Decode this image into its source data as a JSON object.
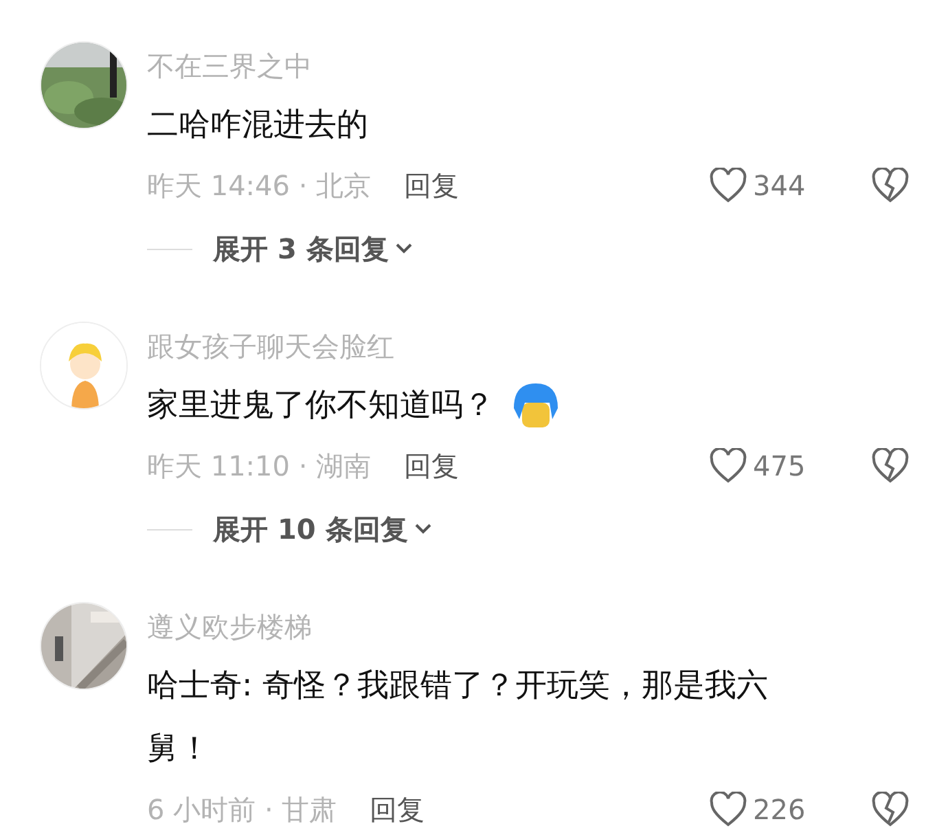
{
  "comments": [
    {
      "username": "不在三界之中",
      "content": "二哈咋混进去的",
      "sticker": false,
      "time_location": "昨天 14:46 · 北京",
      "reply_label": "回复",
      "likes": "344",
      "expand_label": "展开 3 条回复"
    },
    {
      "avatar": {
        "kind": "cartoon"
      },
      "username": "跟女孩子聊天会脸红",
      "content": "家里进鬼了你不知道吗？",
      "sticker": true,
      "time_location": "昨天 11:10 · 湖南",
      "reply_label": "回复",
      "likes": "475",
      "expand_label": "展开 10 条回复"
    },
    {
      "avatar": {
        "kind": "stairs"
      },
      "username": "遵义欧步楼梯",
      "content": "哈士奇: 奇怪？我跟错了？开玩笑，那是我六舅！",
      "sticker": false,
      "time_location": "6 小时前 · 甘肃",
      "reply_label": "回复",
      "likes": "226"
    }
  ]
}
